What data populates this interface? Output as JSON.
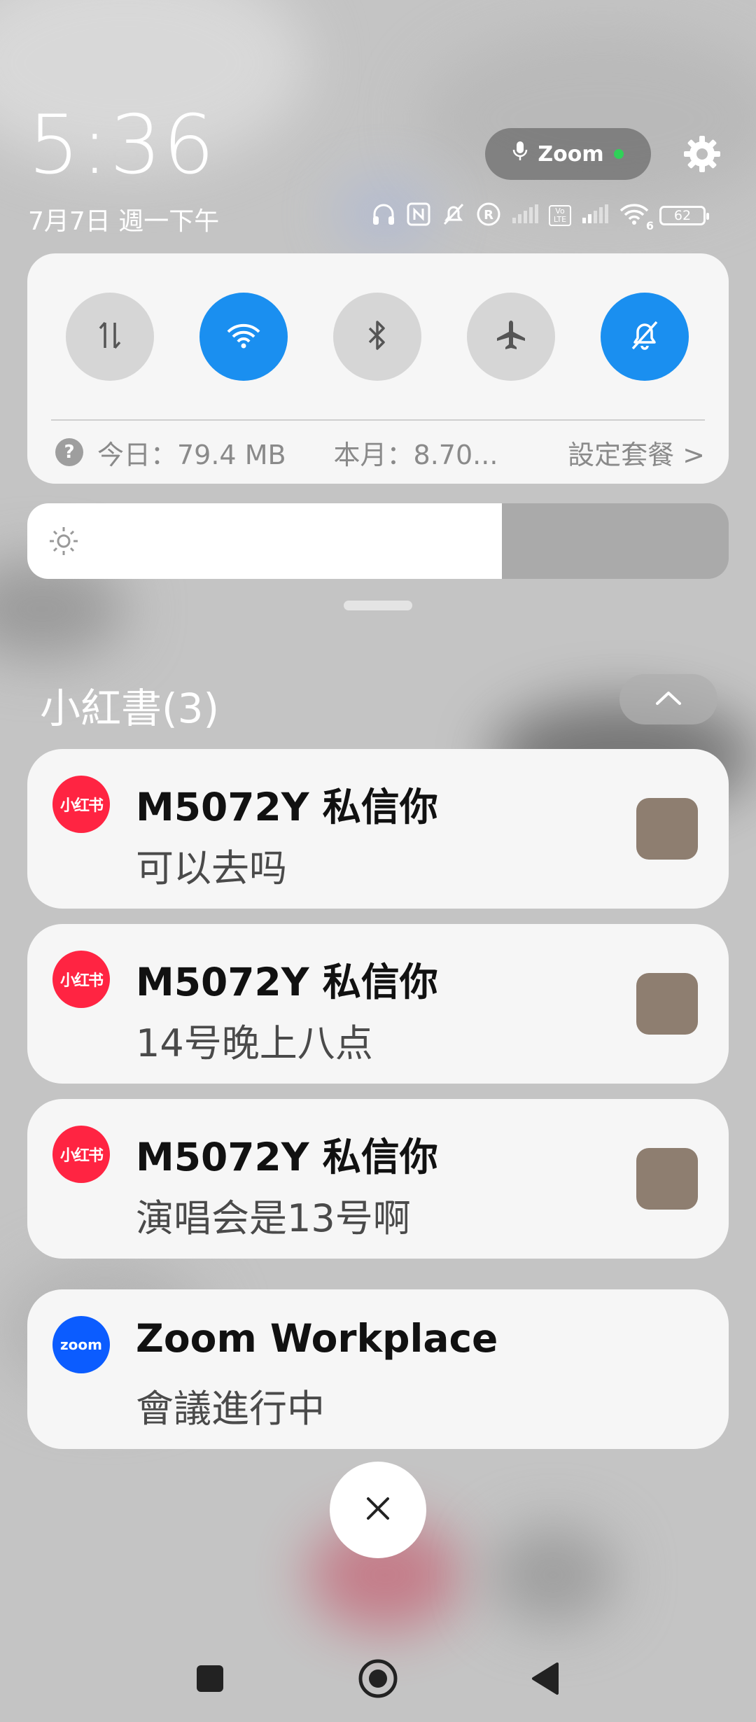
{
  "status": {
    "time": "5:36",
    "date": "7月7日 週一下午",
    "recording_app": "Zoom",
    "battery": "62",
    "network_badge": "Vo LTE",
    "wifi_badge": "6",
    "icons": [
      "headphones-icon",
      "nfc-icon",
      "mute-icon",
      "roaming-icon",
      "signal-icon",
      "volte-icon",
      "signal-icon",
      "wifi-icon",
      "battery-icon"
    ]
  },
  "quick_settings": {
    "toggles": [
      {
        "name": "mobile-data-icon",
        "on": false
      },
      {
        "name": "wifi-icon",
        "on": true
      },
      {
        "name": "bluetooth-icon",
        "on": false
      },
      {
        "name": "airplane-icon",
        "on": false
      },
      {
        "name": "mute-icon",
        "on": true
      }
    ],
    "data_today": "今日：79.4 MB",
    "data_month": "本月：8.70...",
    "plan_link": "設定套餐 >"
  },
  "brightness": {
    "level": 0.677
  },
  "group": {
    "title": "小紅書(3)"
  },
  "notifications": [
    {
      "app": "xhs",
      "icon_text": "小红书",
      "title": "M5072Y 私信你",
      "text": "可以去吗",
      "thumbnail": true
    },
    {
      "app": "xhs",
      "icon_text": "小红书",
      "title": "M5072Y 私信你",
      "text": "14号晚上八点",
      "thumbnail": true
    },
    {
      "app": "xhs",
      "icon_text": "小红书",
      "title": "M5072Y 私信你",
      "text": "演唱会是13号啊",
      "thumbnail": true
    },
    {
      "app": "zoom",
      "icon_text": "zoom",
      "title": "Zoom Workplace",
      "text": "會議進行中",
      "thumbnail": false
    }
  ],
  "colors": {
    "accent": "#1a8ff0",
    "xhs_red": "#ff2442",
    "zoom_blue": "#0b5cff"
  }
}
